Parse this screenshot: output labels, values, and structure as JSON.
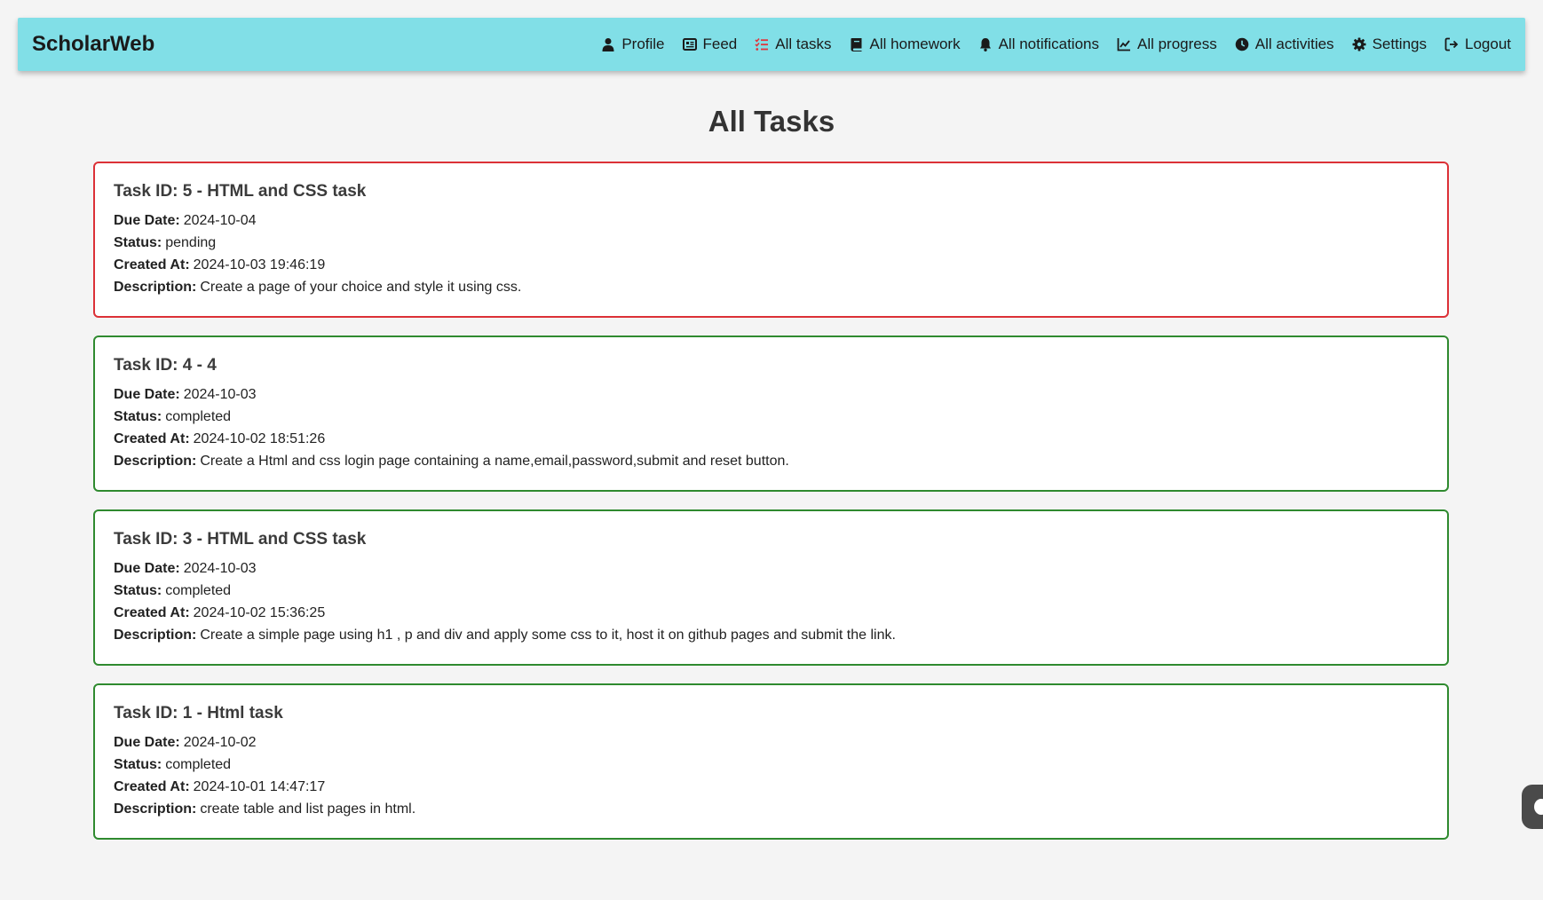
{
  "app": {
    "brand": "ScholarWeb"
  },
  "nav": {
    "items": [
      {
        "label": "Profile",
        "icon": "user-icon"
      },
      {
        "label": "Feed",
        "icon": "newspaper-icon"
      },
      {
        "label": "All tasks",
        "icon": "task-list-icon"
      },
      {
        "label": "All homework",
        "icon": "book-icon"
      },
      {
        "label": "All notifications",
        "icon": "bell-icon"
      },
      {
        "label": "All progress",
        "icon": "chart-line-icon"
      },
      {
        "label": "All activities",
        "icon": "clock-icon"
      },
      {
        "label": "Settings",
        "icon": "gear-icon"
      },
      {
        "label": "Logout",
        "icon": "logout-icon"
      }
    ]
  },
  "main": {
    "title": "All Tasks",
    "labels": {
      "due_date": "Due Date:",
      "status": "Status:",
      "created_at": "Created At:",
      "description": "Description:"
    },
    "tasks": [
      {
        "heading": "Task ID: 5 - HTML and CSS task",
        "due_date": "2024-10-04",
        "status": "pending",
        "created_at": "2024-10-03 19:46:19",
        "description": "Create a page of your choice and style it using css."
      },
      {
        "heading": "Task ID: 4 - 4",
        "due_date": "2024-10-03",
        "status": "completed",
        "created_at": "2024-10-02 18:51:26",
        "description": "Create a Html and css login page containing a name,email,password,submit and reset button."
      },
      {
        "heading": "Task ID: 3 - HTML and CSS task",
        "due_date": "2024-10-03",
        "status": "completed",
        "created_at": "2024-10-02 15:36:25",
        "description": "Create a simple page using h1 , p and div and apply some css to it, host it on github pages and submit the link."
      },
      {
        "heading": "Task ID: 1 - Html task",
        "due_date": "2024-10-02",
        "status": "completed",
        "created_at": "2024-10-01 14:47:17",
        "description": "create table and list pages in html."
      }
    ]
  },
  "colors": {
    "navbar": "#81dfe7",
    "pending_border": "#dc3137",
    "completed_border": "#2f8a2f",
    "active_nav_icon": "#e0343a"
  }
}
